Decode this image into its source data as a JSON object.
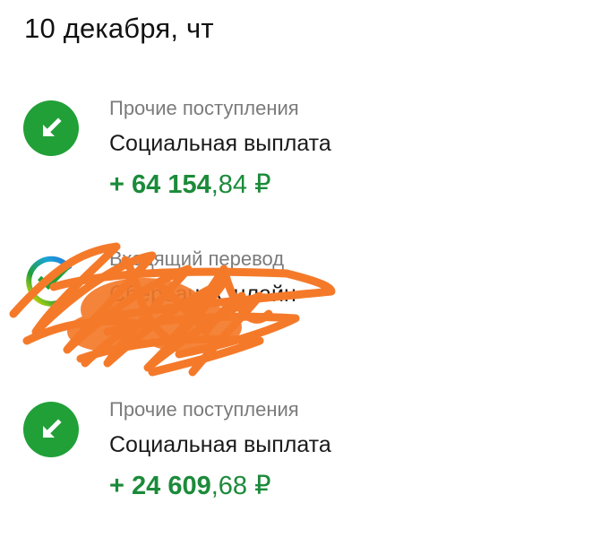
{
  "date_header": "10 декабря, чт",
  "transactions": [
    {
      "category": "Прочие поступления",
      "name": "Социальная выплата",
      "amount_sign": "+ ",
      "amount_major": "64 154",
      "amount_minor": ",84 ₽",
      "icon": "arrow-down-left-icon"
    },
    {
      "category": "Входящий перевод",
      "name": "Сбербанк Онлайн",
      "amount_sign": "",
      "amount_major": "",
      "amount_minor": "",
      "icon": "sberbank-logo-icon",
      "redacted": true
    },
    {
      "category": "Прочие поступления",
      "name": "Социальная выплата",
      "amount_sign": "+ ",
      "amount_major": "24 609",
      "amount_minor": ",68 ₽",
      "icon": "arrow-down-left-icon"
    }
  ],
  "colors": {
    "accent_green": "#21a038",
    "amount_green": "#1b8b3a",
    "category_gray": "#7b7b7b",
    "redaction_orange": "#f47a2a"
  }
}
